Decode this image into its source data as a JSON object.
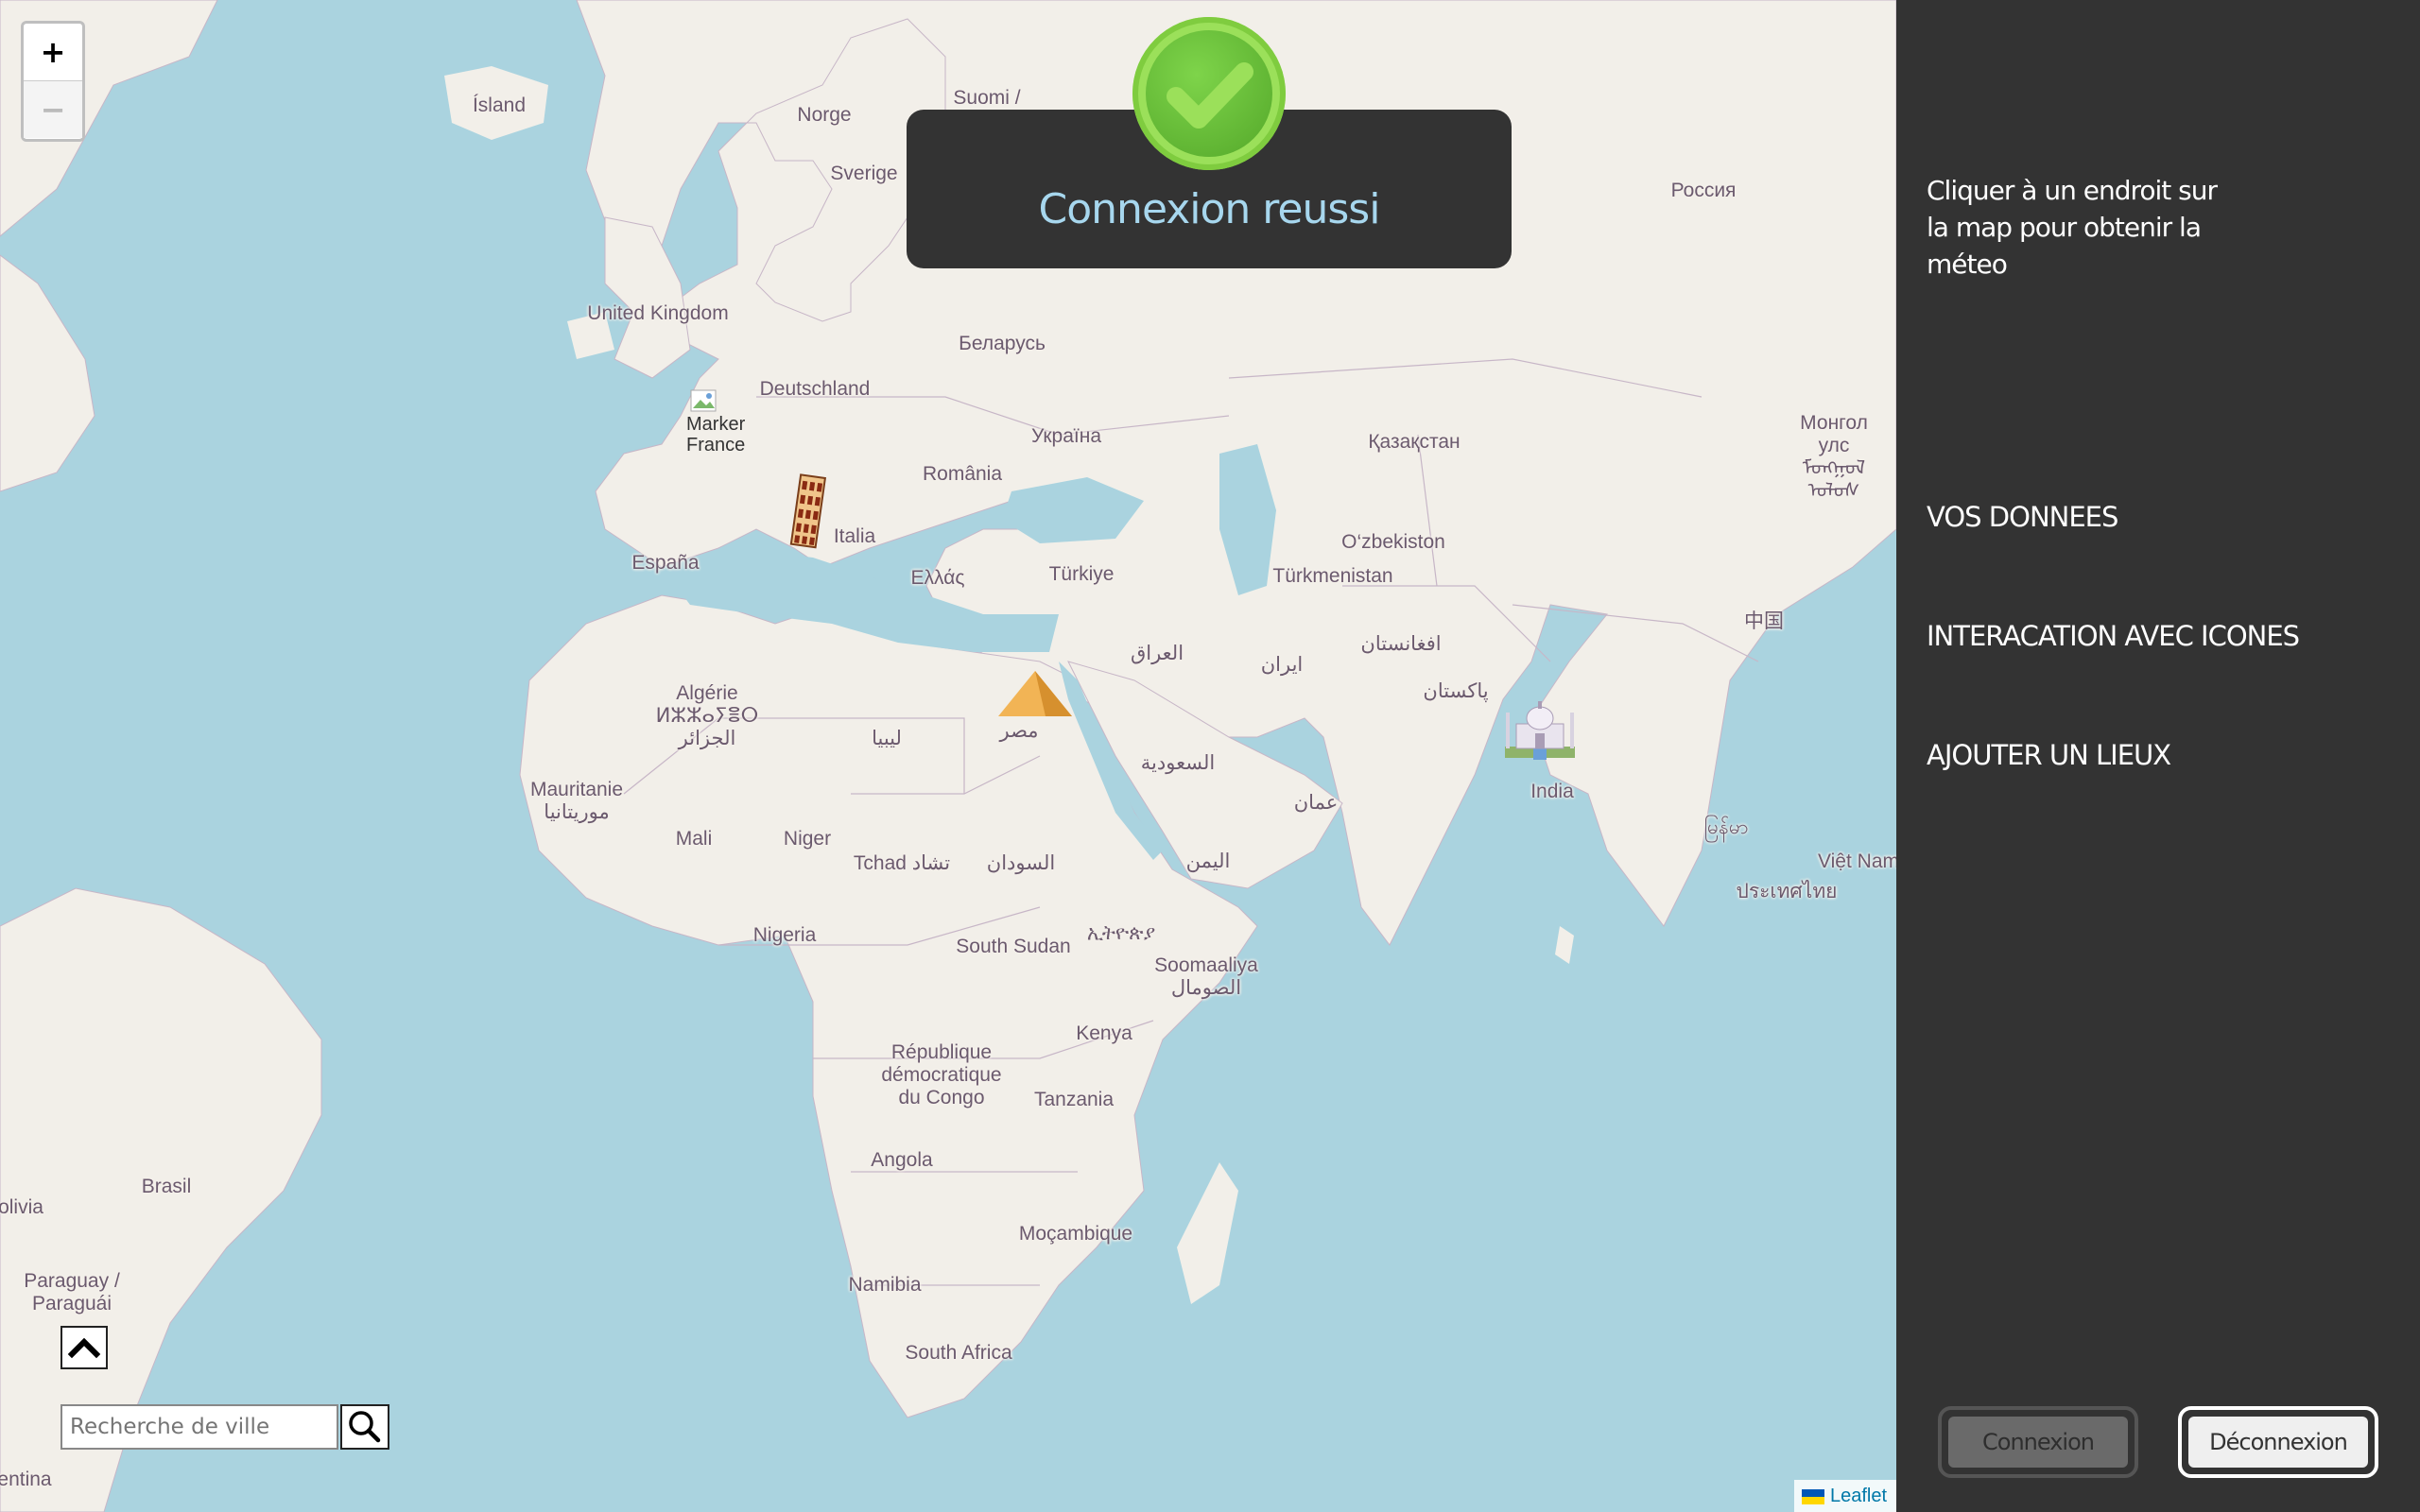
{
  "map": {
    "zoom_in": "+",
    "zoom_out": "−",
    "labels": [
      {
        "id": "island",
        "text": "Ísland"
      },
      {
        "id": "norge",
        "text": "Norge"
      },
      {
        "id": "suomi",
        "text": "Suomi /"
      },
      {
        "id": "sverige",
        "text": "Sverige"
      },
      {
        "id": "rossiya",
        "text": "Россия"
      },
      {
        "id": "uk",
        "text": "United Kingdom"
      },
      {
        "id": "belarus",
        "text": "Беларусь"
      },
      {
        "id": "deutschland",
        "text": "Deutschland"
      },
      {
        "id": "ukraina",
        "text": "Україна"
      },
      {
        "id": "kazakhstan",
        "text": "Қазақстан"
      },
      {
        "id": "mongol",
        "text": "Монгол\nулс ᠮᠣᠩᠭᠣᠯ\nᠤᠯᠤᠰ"
      },
      {
        "id": "romania",
        "text": "România"
      },
      {
        "id": "italia",
        "text": "Italia"
      },
      {
        "id": "espana",
        "text": "España"
      },
      {
        "id": "ellas",
        "text": "Ελλάς"
      },
      {
        "id": "turkiye",
        "text": "Türkiye"
      },
      {
        "id": "uzbekistan",
        "text": "O‘zbekiston"
      },
      {
        "id": "turkmenistan",
        "text": "Türkmenistan"
      },
      {
        "id": "zhongguo",
        "text": "中国"
      },
      {
        "id": "iraq",
        "text": "العراق"
      },
      {
        "id": "iran",
        "text": "ایران"
      },
      {
        "id": "afghanistan",
        "text": "افغانستان"
      },
      {
        "id": "pakistan",
        "text": "پاکستان"
      },
      {
        "id": "algerie",
        "text": "Algérie\nⵍⵣⵣⴰⵢⴻⵔ\nالجزائر"
      },
      {
        "id": "libya",
        "text": "ليبيا"
      },
      {
        "id": "misr",
        "text": "مصر"
      },
      {
        "id": "saudi",
        "text": "السعودية"
      },
      {
        "id": "oman",
        "text": "عمان"
      },
      {
        "id": "india",
        "text": "India"
      },
      {
        "id": "myanmar",
        "text": "မြန်မာ"
      },
      {
        "id": "vietnam",
        "text": "Việt Nam"
      },
      {
        "id": "thailand",
        "text": "ประเทศไทย"
      },
      {
        "id": "mauritanie",
        "text": "Mauritanie\nموريتانيا"
      },
      {
        "id": "mali",
        "text": "Mali"
      },
      {
        "id": "niger",
        "text": "Niger"
      },
      {
        "id": "tchad",
        "text": "Tchad تشاد"
      },
      {
        "id": "sudan",
        "text": "السودان"
      },
      {
        "id": "yemen",
        "text": "اليمن"
      },
      {
        "id": "nigeria",
        "text": "Nigeria"
      },
      {
        "id": "southsudan",
        "text": "South Sudan"
      },
      {
        "id": "ethiopia",
        "text": "ኢትዮጵያ"
      },
      {
        "id": "somalia",
        "text": "Soomaaliya\nالصومال"
      },
      {
        "id": "kenya",
        "text": "Kenya"
      },
      {
        "id": "rdc",
        "text": "République\ndémocratique\ndu Congo"
      },
      {
        "id": "tanzania",
        "text": "Tanzania"
      },
      {
        "id": "angola",
        "text": "Angola"
      },
      {
        "id": "brasil",
        "text": "Brasil"
      },
      {
        "id": "bolivia",
        "text": "olivia"
      },
      {
        "id": "mozambique",
        "text": "Moçambique"
      },
      {
        "id": "namibia",
        "text": "Namibia"
      },
      {
        "id": "southafrica",
        "text": "South Africa"
      },
      {
        "id": "paraguay",
        "text": "Paraguay /\nParaguái"
      },
      {
        "id": "argentina",
        "text": "entina"
      }
    ],
    "marker_france": {
      "alt": "Marker",
      "country": "France"
    },
    "icons": [
      "leaning-tower-icon",
      "pyramid-icon",
      "taj-mahal-icon"
    ],
    "search_placeholder": "Recherche de ville",
    "attribution": "Leaflet"
  },
  "toast": {
    "message": "Connexion reussi"
  },
  "sidebar": {
    "hint": "Cliquer à un endroit sur la map pour obtenir la méteo",
    "menu": [
      "VOS DONNEES",
      "INTERACATION AVEC ICONES",
      "AJOUTER UN LIEUX"
    ],
    "login_label": "Connexion",
    "logout_label": "Déconnexion"
  },
  "colors": {
    "sea": "#aad3df",
    "land": "#f2efe9",
    "panel": "#333333",
    "toast_text": "#a7d7ee",
    "success": "#7ed44a"
  }
}
